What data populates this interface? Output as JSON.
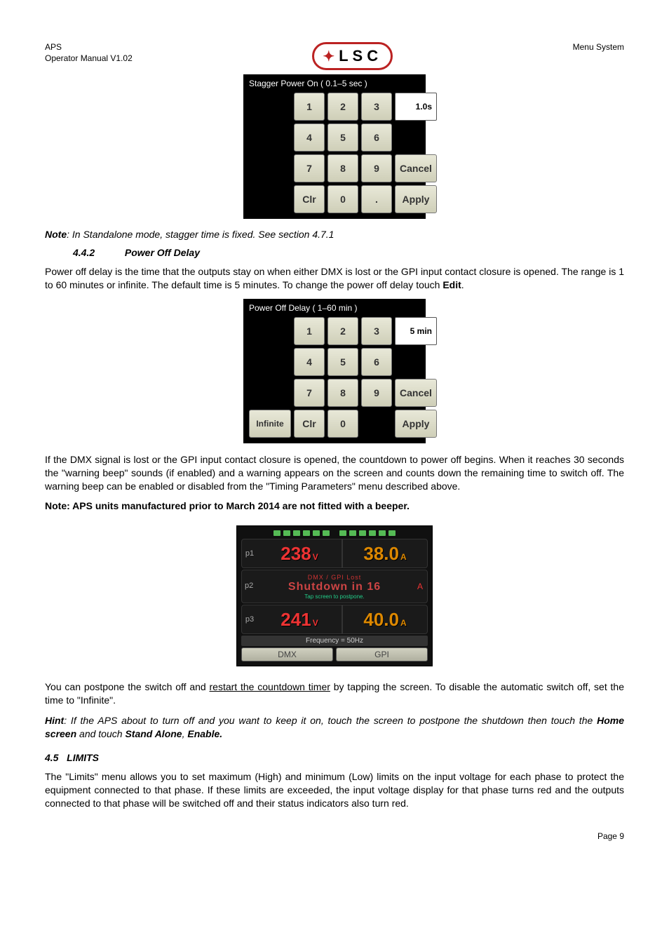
{
  "header": {
    "left_line1": "APS",
    "left_line2": "Operator Manual V1.02",
    "right": "Menu System",
    "logo_text": "LSC"
  },
  "keypad1": {
    "title": "Stagger Power On ( 0.1–5 sec )",
    "display": "1.0s",
    "btn1": "1",
    "btn2": "2",
    "btn3": "3",
    "btn4": "4",
    "btn5": "5",
    "btn6": "6",
    "btn7": "7",
    "btn8": "8",
    "btn9": "9",
    "btnClr": "Clr",
    "btn0": "0",
    "btnDot": ".",
    "btnCancel": "Cancel",
    "btnApply": "Apply"
  },
  "note1": {
    "label": "Note",
    "text": ": In Standalone mode, stagger time is fixed. See section 4.7.1"
  },
  "sec442": {
    "num": "4.4.2",
    "title": "Power Off Delay",
    "para": "Power off delay is the time that the outputs stay on when either DMX is lost or the GPI input contact closure is opened. The range is 1 to 60 minutes or infinite. The default time is 5 minutes. To change the power off delay touch ",
    "edit": "Edit",
    "dot": "."
  },
  "keypad2": {
    "title": "Power Off Delay ( 1–60 min )",
    "display": "5 min",
    "btn1": "1",
    "btn2": "2",
    "btn3": "3",
    "btn4": "4",
    "btn5": "5",
    "btn6": "6",
    "btn7": "7",
    "btn8": "8",
    "btn9": "9",
    "btnInf": "Infinite",
    "btnClr": "Clr",
    "btn0": "0",
    "btnCancel": "Cancel",
    "btnApply": "Apply"
  },
  "para2": "If the DMX signal is lost or the GPI input contact closure is opened, the countdown to power off begins. When it reaches 30 seconds the \"warning beep\" sounds (if enabled) and a warning appears on the screen and counts down the remaining time to switch off. The warning beep can be enabled or disabled from the \"Timing Parameters\" menu described above.",
  "beeper_note": "Note: APS units manufactured prior to March 2014 are not fitted with a beeper.",
  "device": {
    "p1": "p1",
    "p2": "p2",
    "p3": "p3",
    "v1": "238",
    "vu": "V",
    "a1": "38.0",
    "au": "A",
    "warn_top": "DMX / GPI Lost",
    "warn_main": "Shutdown in 16",
    "warn_sub": "Tap screen to postpone.",
    "v3": "241",
    "a3": "40.0",
    "freq": "Frequency = 50Hz",
    "tab1": "DMX",
    "tab2": "GPI"
  },
  "para3a": "You can postpone the switch off and ",
  "para3u": "restart the countdown timer",
  "para3b": " by tapping the screen. To disable the automatic switch off, set the time to \"Infinite\".",
  "hint": {
    "label": "Hint",
    "text1": ": If the APS about to turn off and you want to keep it on, touch the screen to postpone the shutdown then touch the ",
    "hs": "Home screen",
    "text2": " and touch ",
    "sa": "Stand Alone",
    "text3": ", ",
    "en": "Enable."
  },
  "sec45": {
    "num": "4.5",
    "title": "LIMITS",
    "para": "The \"Limits\" menu allows you to set maximum (High) and minimum (Low) limits on the input voltage for each phase to protect the equipment connected to that phase. If these limits are exceeded, the input voltage display for that phase turns red and the outputs connected to that phase will be switched off and their status indicators also turn red."
  },
  "page_num": "Page 9"
}
